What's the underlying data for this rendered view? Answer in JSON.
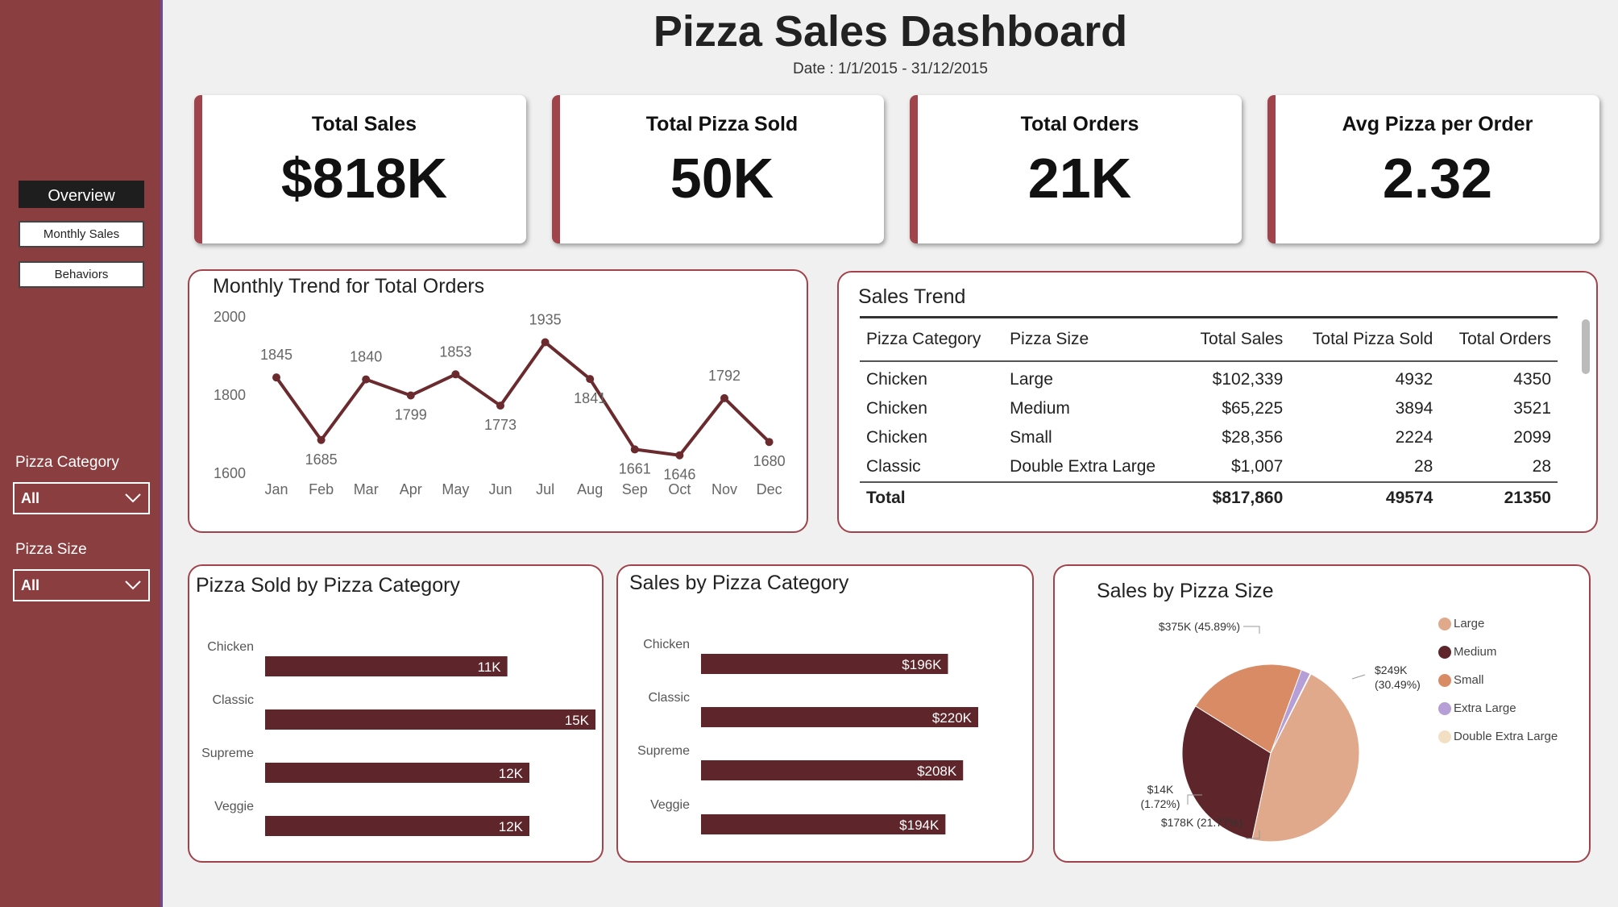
{
  "header": {
    "title": "Pizza Sales Dashboard",
    "date_range": "Date : 1/1/2015 - 31/12/2015"
  },
  "sidebar": {
    "nav": [
      {
        "label": "Overview",
        "active": true
      },
      {
        "label": "Monthly Sales",
        "active": false
      },
      {
        "label": "Behaviors",
        "active": false
      }
    ],
    "filters": [
      {
        "label": "Pizza Category",
        "value": "All",
        "icon": "chevron-down-icon"
      },
      {
        "label": "Pizza Size",
        "value": "All",
        "icon": "chevron-down-icon"
      }
    ]
  },
  "kpis": [
    {
      "label": "Total Sales",
      "value": "$818K"
    },
    {
      "label": "Total Pizza Sold",
      "value": "50K"
    },
    {
      "label": "Total Orders",
      "value": "21K"
    },
    {
      "label": "Avg Pizza per Order",
      "value": "2.32"
    }
  ],
  "colors": {
    "sidebar": "#8b3e3f",
    "accent": "#a0434a",
    "bar": "#5e262a",
    "large": "#e0a98b",
    "medium": "#5e262a",
    "small": "#d98b66",
    "extra_large": "#b69ed6",
    "double_extra_large": "#f3dfc3"
  },
  "sales_trend": {
    "title": "Sales Trend",
    "columns": [
      "Pizza Category",
      "Pizza Size",
      "Total Sales",
      "Total Pizza Sold",
      "Total Orders"
    ],
    "rows": [
      [
        "Chicken",
        "Large",
        "$102,339",
        "4932",
        "4350"
      ],
      [
        "Chicken",
        "Medium",
        "$65,225",
        "3894",
        "3521"
      ],
      [
        "Chicken",
        "Small",
        "$28,356",
        "2224",
        "2099"
      ],
      [
        "Classic",
        "Double Extra Large",
        "$1,007",
        "28",
        "28"
      ]
    ],
    "total": [
      "Total",
      "",
      "$817,860",
      "49574",
      "21350"
    ]
  },
  "chart_data": [
    {
      "type": "line",
      "title": "Monthly Trend for Total Orders",
      "x": [
        "Jan",
        "Feb",
        "Mar",
        "Apr",
        "May",
        "Jun",
        "Jul",
        "Aug",
        "Sep",
        "Oct",
        "Nov",
        "Dec"
      ],
      "series": [
        {
          "values": [
            1845,
            1685,
            1840,
            1799,
            1853,
            1773,
            1935,
            1841,
            1661,
            1646,
            1792,
            1680
          ]
        }
      ],
      "y_ticks": [
        1600,
        1800,
        2000
      ],
      "ylim": [
        1600,
        2000
      ]
    },
    {
      "type": "bar",
      "title": "Pizza Sold by Pizza Category",
      "categories": [
        "Chicken",
        "Classic",
        "Supreme",
        "Veggie"
      ],
      "values": [
        11000,
        15000,
        12000,
        12000
      ],
      "labels": [
        "11K",
        "15K",
        "12K",
        "12K"
      ]
    },
    {
      "type": "bar",
      "title": "Sales by Pizza Category",
      "categories": [
        "Chicken",
        "Classic",
        "Supreme",
        "Veggie"
      ],
      "values": [
        196000,
        220000,
        208000,
        194000
      ],
      "labels": [
        "$196K",
        "$220K",
        "$208K",
        "$194K"
      ]
    },
    {
      "type": "pie",
      "title": "Sales by Pizza Size",
      "categories": [
        "Large",
        "Medium",
        "Small",
        "Extra Large",
        "Double Extra Large"
      ],
      "values": [
        45.89,
        30.49,
        21.77,
        1.72,
        0.12
      ],
      "label_values": [
        "$375K",
        "$249K",
        "$178K",
        "$14K",
        ""
      ],
      "label_pcts": [
        "(45.89%)",
        "(30.49%)",
        "(21.77%)",
        "(1.72%)",
        ""
      ],
      "legend_position": "right"
    }
  ]
}
